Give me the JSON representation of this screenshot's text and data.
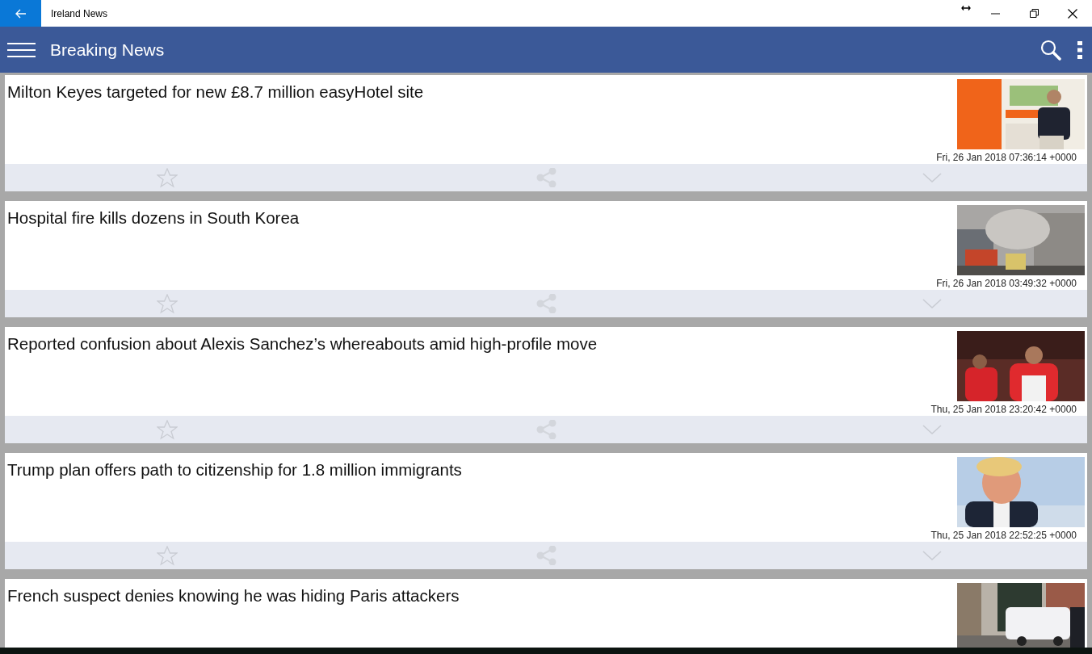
{
  "window": {
    "title": "Ireland News"
  },
  "header": {
    "title": "Breaking News"
  },
  "articles": [
    {
      "title": "Milton Keyes targeted for new £8.7 million easyHotel site",
      "date": "Fri, 26 Jan 2018 07:36:14 +0000",
      "starred": false
    },
    {
      "title": "Hospital fire kills dozens in South Korea",
      "date": "Fri, 26 Jan 2018 03:49:32 +0000",
      "starred": false
    },
    {
      "title": "Reported confusion about Alexis Sanchez’s whereabouts amid high-profile move",
      "date": "Thu, 25 Jan 2018 23:20:42 +0000",
      "starred": false
    },
    {
      "title": "Trump plan offers path to citizenship for 1.8 million immigrants",
      "date": "Thu, 25 Jan 2018 22:52:25 +0000",
      "starred": false
    },
    {
      "title": "French suspect denies knowing he was hiding Paris attackers"
    }
  ]
}
